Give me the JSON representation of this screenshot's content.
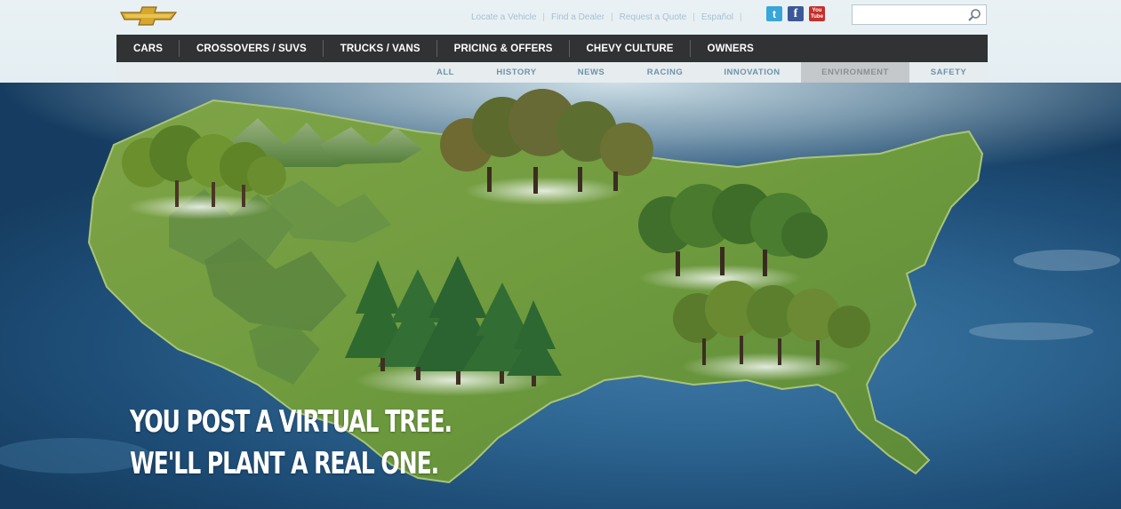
{
  "header": {
    "logo_alt": "Chevrolet bowtie",
    "utility_links": [
      {
        "label": "Locate a Vehicle"
      },
      {
        "label": "Find a Dealer"
      },
      {
        "label": "Request a Quote"
      },
      {
        "label": "Español"
      }
    ],
    "social": [
      {
        "name": "twitter-icon",
        "glyph": "t"
      },
      {
        "name": "facebook-icon",
        "glyph": "f"
      },
      {
        "name": "youtube-icon",
        "glyph": "You Tube"
      }
    ],
    "search": {
      "placeholder": "",
      "value": ""
    }
  },
  "main_nav": {
    "items": [
      {
        "label": "CARS"
      },
      {
        "label": "CROSSOVERS / SUVS"
      },
      {
        "label": "TRUCKS / VANS"
      },
      {
        "label": "PRICING & OFFERS"
      },
      {
        "label": "CHEVY CULTURE"
      },
      {
        "label": "OWNERS"
      }
    ]
  },
  "sub_nav": {
    "items": [
      {
        "label": "ALL"
      },
      {
        "label": "HISTORY"
      },
      {
        "label": "NEWS"
      },
      {
        "label": "RACING"
      },
      {
        "label": "INNOVATION"
      },
      {
        "label": "ENVIRONMENT",
        "active": true
      },
      {
        "label": "SAFETY"
      }
    ]
  },
  "hero": {
    "tagline_line1": "YOU POST A VIRTUAL TREE.",
    "tagline_line2": "WE'LL PLANT A REAL ONE."
  },
  "colors": {
    "nav_bg": "#303234",
    "subnav_bg": "#e7ecef",
    "subnav_active_bg": "#c4c8ca",
    "subnav_text": "#6d94a8",
    "brand_gold": "#d7a72c",
    "ocean": "#2d6591",
    "land": "#6f9b3e"
  }
}
